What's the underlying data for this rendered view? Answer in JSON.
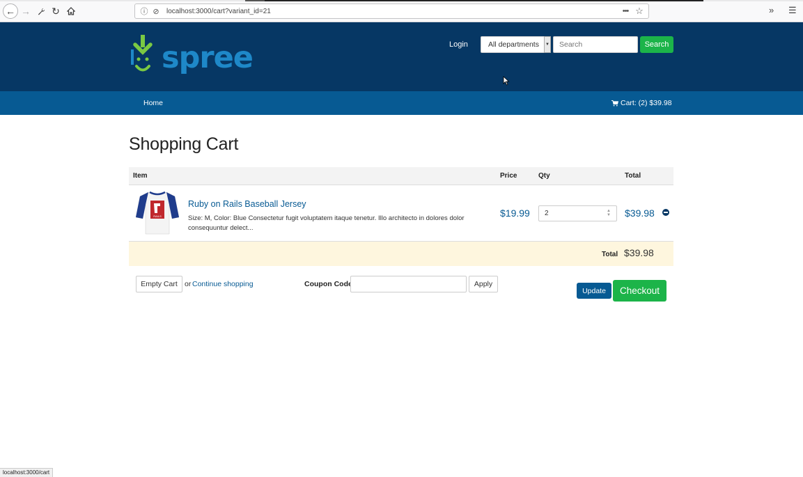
{
  "browser": {
    "url": "localhost:3000/cart?variant_id=21",
    "status_url": "localhost:3000/cart",
    "icons": [
      "back-icon",
      "forward-icon",
      "wrench-icon",
      "reload-icon",
      "home-icon",
      "info-icon",
      "tracking-shield-icon",
      "page-actions-icon",
      "bookmark-star-icon",
      "overflow-icon",
      "menu-icon"
    ]
  },
  "header": {
    "logo_text": "spree",
    "login_label": "Login",
    "department_selected": "All departments",
    "search_placeholder": "Search",
    "search_button": "Search"
  },
  "nav": {
    "home_label": "Home",
    "cart_label": "Cart: (2) $39.98"
  },
  "cart": {
    "title": "Shopping Cart",
    "columns": {
      "item": "Item",
      "price": "Price",
      "qty": "Qty",
      "total": "Total"
    },
    "items": [
      {
        "name": "Ruby on Rails Baseball Jersey",
        "description": "Size: M, Color: Blue Consectetur fugit voluptatem itaque tenetur. Illo architecto in dolores dolor consequuntur delect...",
        "price": "$19.99",
        "qty": "2",
        "total": "$39.98",
        "thumb_text": "RAILS"
      }
    ],
    "order_total_label": "Total",
    "order_total": "$39.98"
  },
  "actions": {
    "empty_cart": "Empty Cart",
    "or_text": "or",
    "continue_shopping": "Continue shopping",
    "coupon_label": "Coupon Code",
    "coupon_value": "",
    "apply": "Apply",
    "update": "Update",
    "checkout": "Checkout"
  },
  "colors": {
    "header_bg": "#063764",
    "navbar_bg": "#075a93",
    "accent_green": "#1cb449",
    "link_blue": "#075a93",
    "total_row_bg": "#fef6de"
  }
}
